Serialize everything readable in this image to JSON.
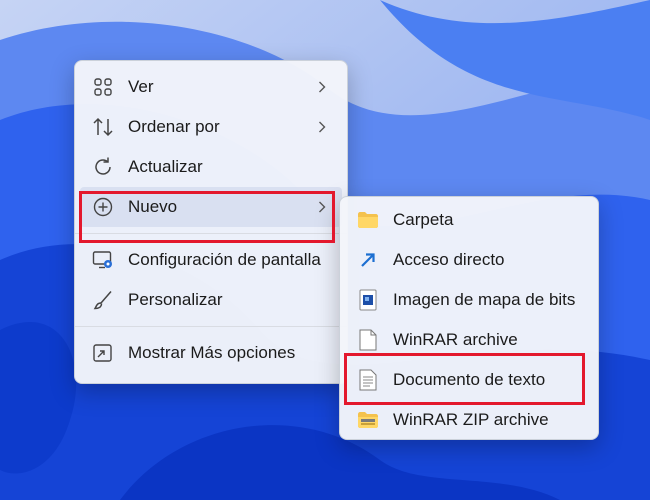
{
  "colors": {
    "highlight": "#e3182d",
    "menu_bg": "#f3f5fa",
    "accent_blue": "#1f4fe0",
    "text": "#1b1b1b"
  },
  "context_menu": {
    "items": [
      {
        "label": "Ver",
        "icon": "grid-view-icon",
        "has_submenu": true
      },
      {
        "label": "Ordenar por",
        "icon": "sort-arrows-icon",
        "has_submenu": true
      },
      {
        "label": "Actualizar",
        "icon": "refresh-icon",
        "has_submenu": false
      },
      {
        "label": "Nuevo",
        "icon": "plus-circle-icon",
        "has_submenu": true,
        "highlighted": true
      },
      {
        "label": "Configuración de pantalla",
        "icon": "display-settings-icon",
        "has_submenu": false
      },
      {
        "label": "Personalizar",
        "icon": "brush-icon",
        "has_submenu": false
      },
      {
        "label": "Mostrar Más opciones",
        "icon": "expand-window-icon",
        "has_submenu": false
      }
    ]
  },
  "new_submenu": {
    "items": [
      {
        "label": "Carpeta",
        "icon": "folder-icon"
      },
      {
        "label": "Acceso directo",
        "icon": "shortcut-icon"
      },
      {
        "label": "Imagen de mapa de bits",
        "icon": "bitmap-icon"
      },
      {
        "label": "WinRAR archive",
        "icon": "blank-file-icon"
      },
      {
        "label": "Documento de texto",
        "icon": "text-document-icon",
        "highlighted": true
      },
      {
        "label": "WinRAR ZIP archive",
        "icon": "zip-folder-icon"
      }
    ]
  }
}
